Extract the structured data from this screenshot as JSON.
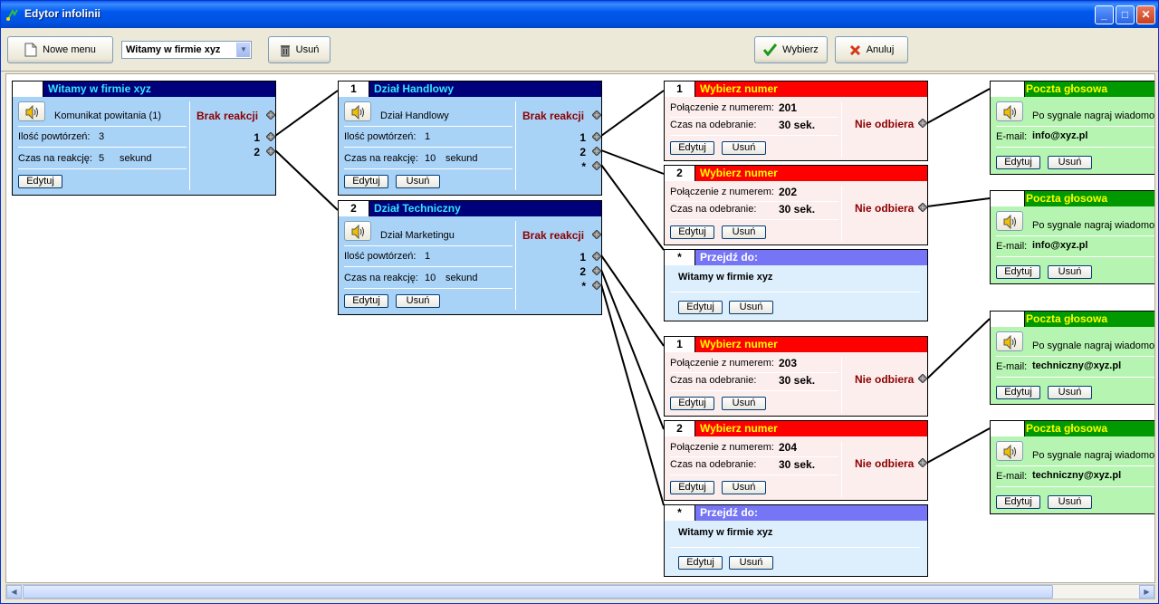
{
  "window": {
    "title": "Edytor infolinii",
    "minimize": "_",
    "maximize": "□",
    "close": "✕"
  },
  "toolbar": {
    "new_menu": "Nowe menu",
    "menu_select": "Witamy w firmie xyz",
    "delete": "Usuń",
    "choose": "Wybierz",
    "cancel": "Anuluj"
  },
  "menus": [
    {
      "num": "",
      "title": "Witamy w firmie xyz",
      "message": "Komunikat powitania (1)",
      "repeat_label": "Ilość powtórzeń:",
      "repeat": "3",
      "time_label": "Czas na reakcję:",
      "time": "5",
      "unit": "sekund",
      "no_reaction": "Brak reakcji",
      "options": [
        "1",
        "2"
      ],
      "edit": "Edytuj"
    },
    {
      "num": "1",
      "title": "Dział Handlowy",
      "message": "Dział Handlowy",
      "repeat_label": "Ilość powtórzeń:",
      "repeat": "1",
      "time_label": "Czas na reakcję:",
      "time": "10",
      "unit": "sekund",
      "no_reaction": "Brak reakcji",
      "options": [
        "1",
        "2",
        "*"
      ],
      "edit": "Edytuj",
      "delete": "Usuń"
    },
    {
      "num": "2",
      "title": "Dział Techniczny",
      "message": "Dział Marketingu",
      "repeat_label": "Ilość powtórzeń:",
      "repeat": "1",
      "time_label": "Czas na reakcję:",
      "time": "10",
      "unit": "sekund",
      "no_reaction": "Brak reakcji",
      "options": [
        "1",
        "2",
        "*"
      ],
      "edit": "Edytuj",
      "delete": "Usuń"
    }
  ],
  "calls": [
    {
      "num": "1",
      "title": "Wybierz numer",
      "conn_label": "Połączenie z numerem:",
      "number": "201",
      "time_label": "Czas na odebranie:",
      "time": "30 sek.",
      "no_answer": "Nie odbiera",
      "edit": "Edytuj",
      "delete": "Usuń"
    },
    {
      "num": "2",
      "title": "Wybierz numer",
      "conn_label": "Połączenie z numerem:",
      "number": "202",
      "time_label": "Czas na odebranie:",
      "time": "30 sek.",
      "no_answer": "Nie odbiera",
      "edit": "Edytuj",
      "delete": "Usuń"
    },
    {
      "num": "1",
      "title": "Wybierz numer",
      "conn_label": "Połączenie z numerem:",
      "number": "203",
      "time_label": "Czas na odebranie:",
      "time": "30 sek.",
      "no_answer": "Nie odbiera",
      "edit": "Edytuj",
      "delete": "Usuń"
    },
    {
      "num": "2",
      "title": "Wybierz numer",
      "conn_label": "Połączenie z numerem:",
      "number": "204",
      "time_label": "Czas na odebranie:",
      "time": "30 sek.",
      "no_answer": "Nie odbiera",
      "edit": "Edytuj",
      "delete": "Usuń"
    }
  ],
  "jumps": [
    {
      "num": "*",
      "title": "Przejdź do:",
      "target": "Witamy w firmie xyz",
      "edit": "Edytuj",
      "delete": "Usuń"
    },
    {
      "num": "*",
      "title": "Przejdź do:",
      "target": "Witamy w firmie xyz",
      "edit": "Edytuj",
      "delete": "Usuń"
    }
  ],
  "mailboxes": [
    {
      "title": "Poczta głosowa",
      "message": "Po sygnale nagraj wiadomość",
      "email_label": "E-mail:",
      "email": "info@xyz.pl",
      "edit": "Edytuj",
      "delete": "Usuń"
    },
    {
      "title": "Poczta głosowa",
      "message": "Po sygnale nagraj wiadomość",
      "email_label": "E-mail:",
      "email": "info@xyz.pl",
      "edit": "Edytuj",
      "delete": "Usuń"
    },
    {
      "title": "Poczta głosowa",
      "message": "Po sygnale nagraj wiadomość",
      "email_label": "E-mail:",
      "email": "techniczny@xyz.pl",
      "edit": "Edytuj",
      "delete": "Usuń"
    },
    {
      "title": "Poczta głosowa",
      "message": "Po sygnale nagraj wiadomość",
      "email_label": "E-mail:",
      "email": "techniczny@xyz.pl",
      "edit": "Edytuj",
      "delete": "Usuń"
    }
  ],
  "colors": {
    "menu_header": "#00007a",
    "menu_title": "#35e6ff",
    "call_header": "#ff0000",
    "jump_header": "#7575f5",
    "mail_header": "#009a00",
    "no_reaction": "#8b0000"
  },
  "icons": [
    "app-icon",
    "new-document-icon",
    "trash-icon",
    "check-icon",
    "cancel-x-icon",
    "speaker-icon",
    "connector-dot-icon"
  ]
}
